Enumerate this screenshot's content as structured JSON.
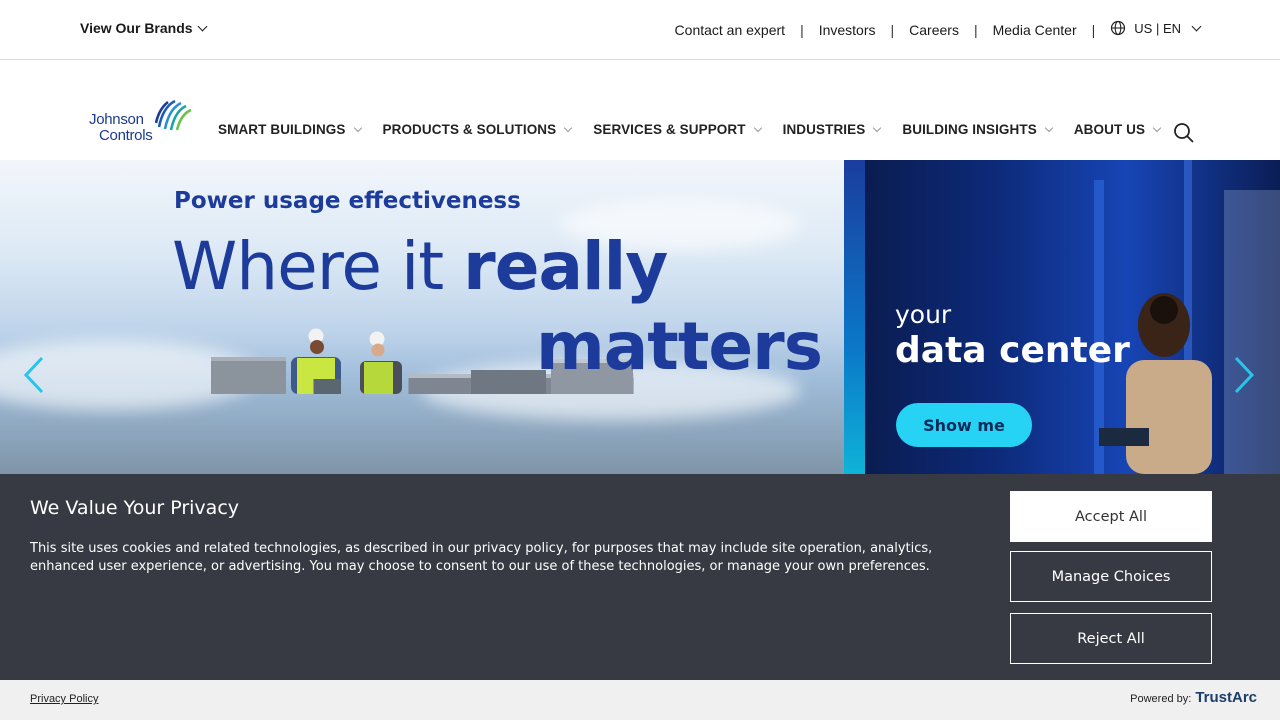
{
  "utility": {
    "brands_label": "View Our Brands",
    "links": [
      "Contact an expert",
      "Investors",
      "Careers",
      "Media Center"
    ],
    "separator": "|",
    "locale": "US | EN"
  },
  "logo": {
    "line1": "Johnson",
    "line2": "Controls"
  },
  "nav": {
    "items": [
      "SMART BUILDINGS",
      "PRODUCTS & SOLUTIONS",
      "SERVICES & SUPPORT",
      "INDUSTRIES",
      "BUILDING INSIGHTS",
      "ABOUT US"
    ]
  },
  "hero": {
    "eyebrow": "Power usage effectiveness",
    "headline_regular": "Where it ",
    "headline_bold": "really",
    "headline_line2": "matters",
    "side_small": "your",
    "side_big": "data center",
    "cta": "Show me"
  },
  "cookie": {
    "title": "We Value Your Privacy",
    "body": "This site uses cookies and related technologies, as described in our privacy policy, for purposes that may include site operation, analytics, enhanced user experience, or advertising. You may choose to consent to our use of these technologies, or manage your own preferences.",
    "accept": "Accept All",
    "manage": "Manage Choices",
    "reject": "Reject All",
    "privacy_link": "Privacy Policy",
    "powered_by": "Powered by:",
    "vendor": "TrustArc"
  },
  "colors": {
    "brand_blue": "#1d3b9a",
    "cta_cyan": "#27d3f5",
    "banner_bg": "#373a42"
  }
}
